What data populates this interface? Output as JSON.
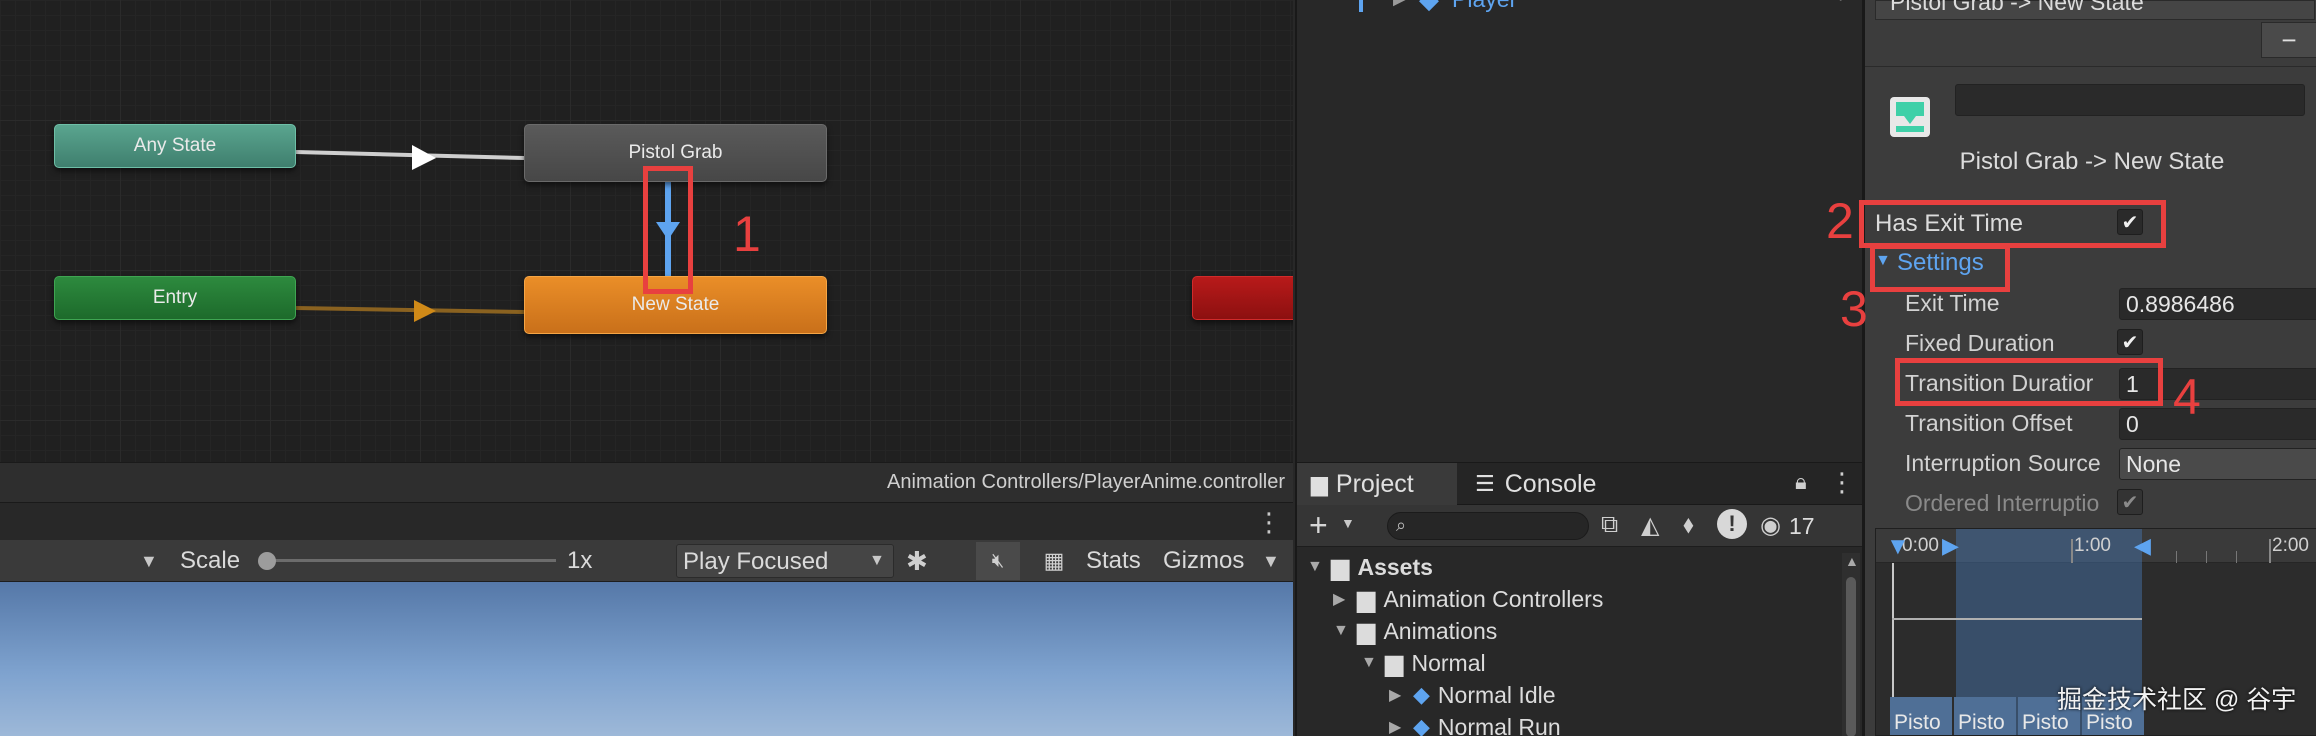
{
  "animator": {
    "nodes": {
      "any_state": "Any State",
      "entry": "Entry",
      "pistol_grab": "Pistol Grab",
      "new_state": "New State"
    },
    "footer_path": "Animation Controllers/PlayerAnime.controller"
  },
  "hierarchy": {
    "partial_item": "Player"
  },
  "game_view": {
    "scale_label": "Scale",
    "scale_value": "1x",
    "play_mode": "Play Focused",
    "stats_label": "Stats",
    "gizmos_label": "Gizmos"
  },
  "project": {
    "tab_project": "Project",
    "tab_console": "Console",
    "visibility_count": "17",
    "tree": [
      {
        "label": "Assets"
      },
      {
        "label": "Animation Controllers"
      },
      {
        "label": "Animations"
      },
      {
        "label": "Normal"
      },
      {
        "label": "Normal Idle"
      },
      {
        "label": "Normal Run"
      }
    ]
  },
  "inspector": {
    "partial_header": "Pistol Grab -> New State",
    "minus_label": "−",
    "transition_title": "Pistol Grab -> New State",
    "has_exit_time_label": "Has Exit Time",
    "settings_label": "Settings",
    "exit_time_label": "Exit Time",
    "exit_time_value": "0.8986486",
    "fixed_duration_label": "Fixed Duration",
    "transition_duration_label": "Transition Duratior",
    "transition_duration_value": "1",
    "transition_offset_label": "Transition Offset",
    "transition_offset_value": "0",
    "interruption_source_label": "Interruption Source",
    "interruption_source_value": "None",
    "ordered_interruption_label": "Ordered Interruptio",
    "timeline": {
      "tick_0": "0:00",
      "tick_1": "1:00",
      "tick_2": "2:00",
      "clip_labels": [
        "Pisto",
        "Pisto",
        "Pisto",
        "Pisto"
      ]
    }
  },
  "annotations": [
    "1",
    "2",
    "3",
    "4"
  ],
  "watermark": "掘金技术社区 @ 谷宇",
  "colors": {
    "annotation_red": "#e8403f",
    "new_state_orange": "#d97b20",
    "any_state_teal": "#4d9582",
    "entry_green": "#257a35",
    "link_blue": "#5ea4f0"
  }
}
